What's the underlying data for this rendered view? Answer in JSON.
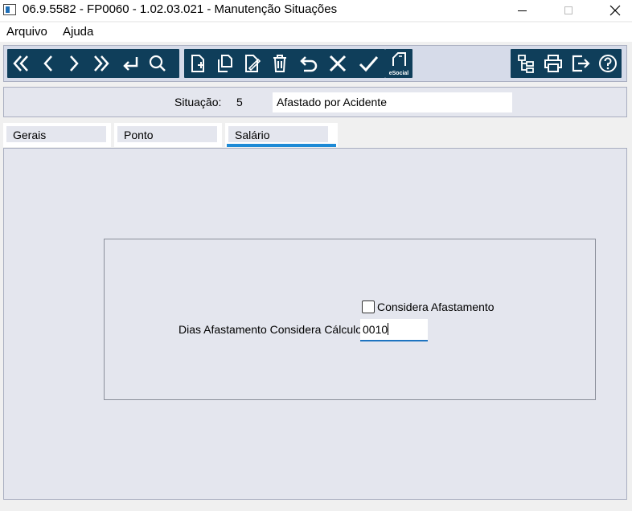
{
  "window": {
    "title": "06.9.5582 - FP0060 - 1.02.03.021 - Manutenção Situações"
  },
  "menu": {
    "items": [
      {
        "label": "Arquivo"
      },
      {
        "label": "Ajuda"
      }
    ]
  },
  "toolbar": {
    "esocial_label": "eSocial",
    "icons": [
      "first-icon",
      "previous-icon",
      "next-icon",
      "last-icon",
      "return-icon",
      "search-icon",
      "new-icon",
      "copy-icon",
      "edit-icon",
      "delete-icon",
      "undo-icon",
      "cancel-icon",
      "confirm-icon",
      "esocial-icon",
      "hierarchy-icon",
      "print-icon",
      "exit-icon",
      "help-icon"
    ]
  },
  "header": {
    "situacao_label": "Situação:",
    "situacao_code": "5",
    "situacao_desc": "Afastado por Acidente"
  },
  "tabs": [
    {
      "label": "Gerais"
    },
    {
      "label": "Ponto"
    },
    {
      "label": "Salário",
      "active": true
    }
  ],
  "form": {
    "considera_afastamento_label": "Considera Afastamento",
    "considera_afastamento_checked": false,
    "dias_label": "Dias Afastamento Considera Cálculo:",
    "dias_value": "0010"
  },
  "colors": {
    "toolbar_button_bg": "#0f3e5a",
    "accent": "#1e8ad6"
  }
}
